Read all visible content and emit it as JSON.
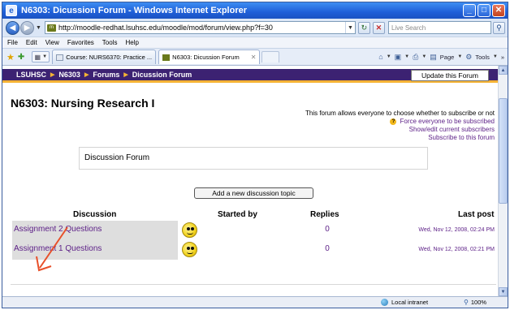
{
  "window": {
    "title": "N6303: Dicussion Forum - Windows Internet Explorer",
    "minimize": "_",
    "maximize": "□",
    "close": "✕"
  },
  "address": {
    "url": "http://moodle-redhat.lsuhsc.edu/moodle/mod/forum/view.php?f=30",
    "search_placeholder": "Live Search"
  },
  "menu": [
    "File",
    "Edit",
    "View",
    "Favorites",
    "Tools",
    "Help"
  ],
  "tabs": [
    {
      "label": "Course: NURS6370: Practice ...",
      "active": false
    },
    {
      "label": "N6303: Dicussion Forum",
      "active": true
    }
  ],
  "commandbar": {
    "page": "Page",
    "tools": "Tools"
  },
  "navbar": {
    "crumbs": [
      "LSUHSC",
      "N6303",
      "Forums",
      "Dicussion Forum"
    ],
    "update_button": "Update this Forum"
  },
  "course": {
    "title": "N6303: Nursing Research I"
  },
  "subscription": {
    "info": "This forum allows everyone to choose whether to subscribe or not",
    "force": "Force everyone to be subscribed",
    "show_edit": "Show/edit current subscribers",
    "subscribe": "Subscribe to this forum"
  },
  "intro": {
    "text": "Discussion Forum"
  },
  "add_topic_button": "Add a new discussion topic",
  "table": {
    "headers": {
      "discussion": "Discussion",
      "started_by": "Started by",
      "replies": "Replies",
      "last_post": "Last post"
    },
    "rows": [
      {
        "topic": "Assignment 2 Questions",
        "replies": "0",
        "last_post": "Wed, Nov 12, 2008, 02:24 PM"
      },
      {
        "topic": "Assignment 1 Questions",
        "replies": "0",
        "last_post": "Wed, Nov 12, 2008, 02:21 PM"
      }
    ]
  },
  "annotation": {
    "color": "#e8502a"
  },
  "status": {
    "zone": "Local intranet",
    "zoom": "100%"
  }
}
